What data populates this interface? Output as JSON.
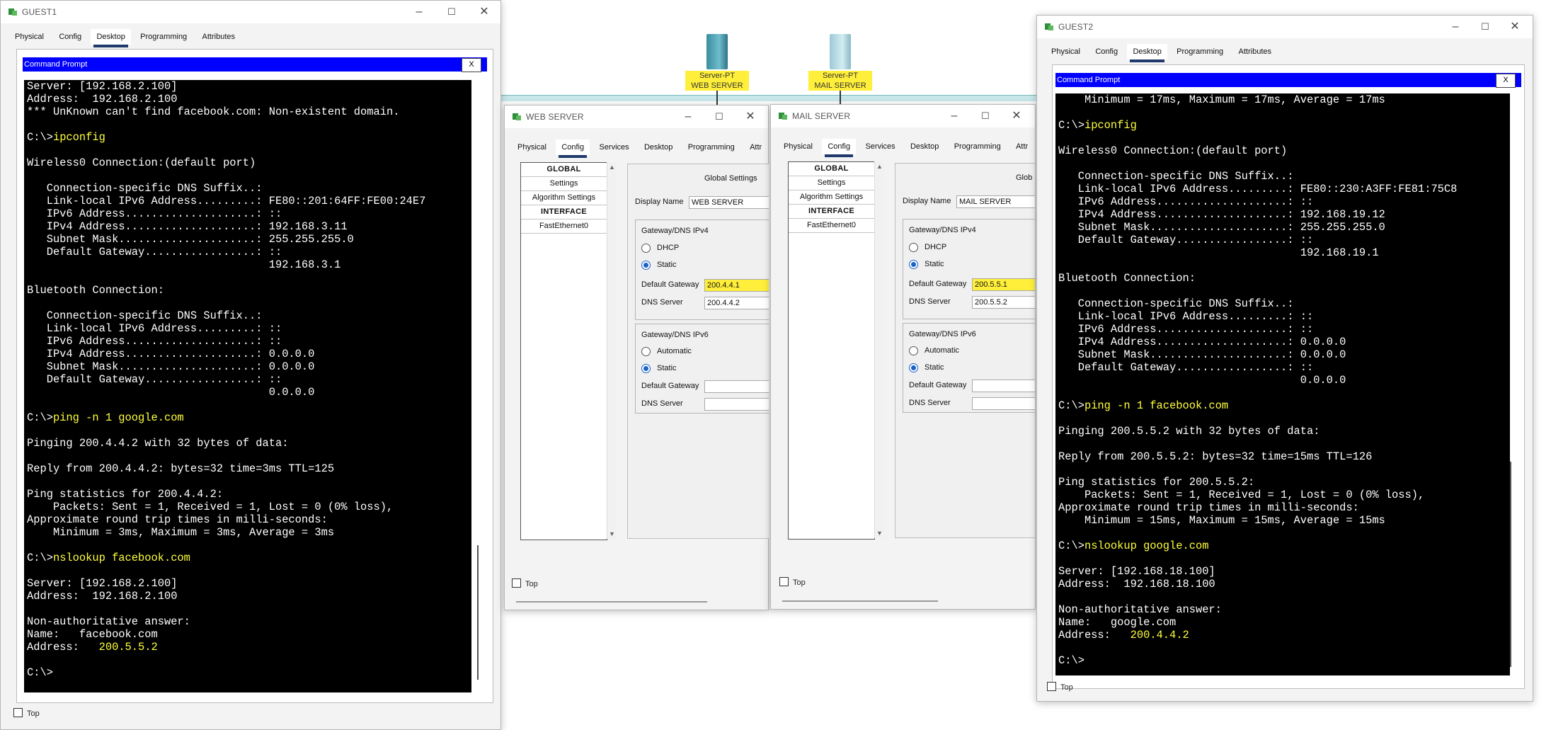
{
  "colors": {
    "cmd_bar": "#0000ff",
    "terminal_bg": "#000000",
    "highlight": "#ffef3a",
    "active_tab_underline": "#1f3a6b"
  },
  "canvas": {
    "web_server_label": {
      "line1": "Server-PT",
      "line2": "WEB SERVER"
    },
    "mail_server_label": {
      "line1": "Server-PT",
      "line2": "MAIL SERVER"
    }
  },
  "tabs_labels": [
    "Physical",
    "Config",
    "Desktop",
    "Programming",
    "Attributes"
  ],
  "guest1": {
    "title": "GUEST1",
    "tabs": [
      "Physical",
      "Config",
      "Desktop",
      "Programming",
      "Attributes"
    ],
    "active_tab": "Desktop",
    "cmd_title": "Command Prompt",
    "close_label": "X",
    "top_label": "Top",
    "lines": [
      {
        "t": "Server: [192.168.2.100]"
      },
      {
        "t": "Address:  192.168.2.100"
      },
      {
        "t": "*** UnKnown can't find facebook.com: Non-existent domain."
      },
      {
        "t": ""
      },
      {
        "p": "C:\\>",
        "c": "ipconfig"
      },
      {
        "t": ""
      },
      {
        "t": "Wireless0 Connection:(default port)"
      },
      {
        "t": ""
      },
      {
        "t": "   Connection-specific DNS Suffix..:"
      },
      {
        "t": "   Link-local IPv6 Address.........: FE80::201:64FF:FE00:24E7"
      },
      {
        "t": "   IPv6 Address....................: ::"
      },
      {
        "t": "   IPv4 Address....................: 192.168.3.11"
      },
      {
        "t": "   Subnet Mask.....................: 255.255.255.0"
      },
      {
        "t": "   Default Gateway.................: ::"
      },
      {
        "t": "                                     192.168.3.1"
      },
      {
        "t": ""
      },
      {
        "t": "Bluetooth Connection:"
      },
      {
        "t": ""
      },
      {
        "t": "   Connection-specific DNS Suffix..:"
      },
      {
        "t": "   Link-local IPv6 Address.........: ::"
      },
      {
        "t": "   IPv6 Address....................: ::"
      },
      {
        "t": "   IPv4 Address....................: 0.0.0.0"
      },
      {
        "t": "   Subnet Mask.....................: 0.0.0.0"
      },
      {
        "t": "   Default Gateway.................: ::"
      },
      {
        "t": "                                     0.0.0.0"
      },
      {
        "t": ""
      },
      {
        "p": "C:\\>",
        "c": "ping -n 1 google.com"
      },
      {
        "t": ""
      },
      {
        "t": "Pinging 200.4.4.2 with 32 bytes of data:"
      },
      {
        "t": ""
      },
      {
        "t": "Reply from 200.4.4.2: bytes=32 time=3ms TTL=125"
      },
      {
        "t": ""
      },
      {
        "t": "Ping statistics for 200.4.4.2:"
      },
      {
        "t": "    Packets: Sent = 1, Received = 1, Lost = 0 (0% loss),"
      },
      {
        "t": "Approximate round trip times in milli-seconds:"
      },
      {
        "t": "    Minimum = 3ms, Maximum = 3ms, Average = 3ms"
      },
      {
        "t": ""
      },
      {
        "p": "C:\\>",
        "c": "nslookup facebook.com"
      },
      {
        "t": ""
      },
      {
        "t": "Server: [192.168.2.100]"
      },
      {
        "t": "Address:  192.168.2.100"
      },
      {
        "t": ""
      },
      {
        "t": "Non-authoritative answer:"
      },
      {
        "t": "Name:   facebook.com"
      },
      {
        "p": "Address:   ",
        "c": "200.5.5.2"
      },
      {
        "t": ""
      },
      {
        "t": "C:\\>"
      }
    ]
  },
  "guest2": {
    "title": "GUEST2",
    "tabs": [
      "Physical",
      "Config",
      "Desktop",
      "Programming",
      "Attributes"
    ],
    "active_tab": "Desktop",
    "cmd_title": "Command Prompt",
    "close_label": "X",
    "top_label": "Top",
    "lines": [
      {
        "t": "    Minimum = 17ms, Maximum = 17ms, Average = 17ms"
      },
      {
        "t": ""
      },
      {
        "p": "C:\\>",
        "c": "ipconfig"
      },
      {
        "t": ""
      },
      {
        "t": "Wireless0 Connection:(default port)"
      },
      {
        "t": ""
      },
      {
        "t": "   Connection-specific DNS Suffix..:"
      },
      {
        "t": "   Link-local IPv6 Address.........: FE80::230:A3FF:FE81:75C8"
      },
      {
        "t": "   IPv6 Address....................: ::"
      },
      {
        "t": "   IPv4 Address....................: 192.168.19.12"
      },
      {
        "t": "   Subnet Mask.....................: 255.255.255.0"
      },
      {
        "t": "   Default Gateway.................: ::"
      },
      {
        "t": "                                     192.168.19.1"
      },
      {
        "t": ""
      },
      {
        "t": "Bluetooth Connection:"
      },
      {
        "t": ""
      },
      {
        "t": "   Connection-specific DNS Suffix..:"
      },
      {
        "t": "   Link-local IPv6 Address.........: ::"
      },
      {
        "t": "   IPv6 Address....................: ::"
      },
      {
        "t": "   IPv4 Address....................: 0.0.0.0"
      },
      {
        "t": "   Subnet Mask.....................: 0.0.0.0"
      },
      {
        "t": "   Default Gateway.................: ::"
      },
      {
        "t": "                                     0.0.0.0"
      },
      {
        "t": ""
      },
      {
        "p": "C:\\>",
        "c": "ping -n 1 facebook.com"
      },
      {
        "t": ""
      },
      {
        "t": "Pinging 200.5.5.2 with 32 bytes of data:"
      },
      {
        "t": ""
      },
      {
        "t": "Reply from 200.5.5.2: bytes=32 time=15ms TTL=126"
      },
      {
        "t": ""
      },
      {
        "t": "Ping statistics for 200.5.5.2:"
      },
      {
        "t": "    Packets: Sent = 1, Received = 1, Lost = 0 (0% loss),"
      },
      {
        "t": "Approximate round trip times in milli-seconds:"
      },
      {
        "t": "    Minimum = 15ms, Maximum = 15ms, Average = 15ms"
      },
      {
        "t": ""
      },
      {
        "p": "C:\\>",
        "c": "nslookup google.com"
      },
      {
        "t": ""
      },
      {
        "t": "Server: [192.168.18.100]"
      },
      {
        "t": "Address:  192.168.18.100"
      },
      {
        "t": ""
      },
      {
        "t": "Non-authoritative answer:"
      },
      {
        "t": "Name:   google.com"
      },
      {
        "p": "Address:   ",
        "c": "200.4.4.2"
      },
      {
        "t": ""
      },
      {
        "t": "C:\\>"
      }
    ]
  },
  "web_server": {
    "title": "WEB SERVER",
    "tabs": [
      "Physical",
      "Config",
      "Services",
      "Desktop",
      "Programming",
      "Attr"
    ],
    "active_tab": "Config",
    "sidebar": [
      "GLOBAL",
      "Settings",
      "Algorithm Settings",
      "INTERFACE",
      "FastEthernet0"
    ],
    "section_title": "Global Settings",
    "display_name_label": "Display Name",
    "display_name": "WEB SERVER",
    "ipv4_group": "Gateway/DNS IPv4",
    "dhcp_label": "DHCP",
    "static_label": "Static",
    "default_gateway_label": "Default Gateway",
    "default_gateway": "200.4.4.1",
    "dns_server_label": "DNS Server",
    "dns_server": "200.4.4.2",
    "ipv6_group": "Gateway/DNS IPv6",
    "automatic_label": "Automatic",
    "static6_label": "Static",
    "default_gateway6_label": "Default Gateway",
    "default_gateway6": "",
    "dns_server6_label": "DNS Server",
    "dns_server6": "",
    "top_label": "Top"
  },
  "mail_server": {
    "title": "MAIL SERVER",
    "tabs": [
      "Physical",
      "Config",
      "Services",
      "Desktop",
      "Programming",
      "Attr"
    ],
    "active_tab": "Config",
    "sidebar": [
      "GLOBAL",
      "Settings",
      "Algorithm Settings",
      "INTERFACE",
      "FastEthernet0"
    ],
    "section_title": "Glob",
    "display_name_label": "Display Name",
    "display_name": "MAIL SERVER",
    "ipv4_group": "Gateway/DNS IPv4",
    "dhcp_label": "DHCP",
    "static_label": "Static",
    "default_gateway_label": "Default Gateway",
    "default_gateway": "200.5.5.1",
    "dns_server_label": "DNS Server",
    "dns_server": "200.5.5.2",
    "ipv6_group": "Gateway/DNS IPv6",
    "automatic_label": "Automatic",
    "static6_label": "Static",
    "default_gateway6_label": "Default Gateway",
    "default_gateway6": "",
    "dns_server6_label": "DNS Server",
    "dns_server6": "",
    "top_label": "Top"
  }
}
